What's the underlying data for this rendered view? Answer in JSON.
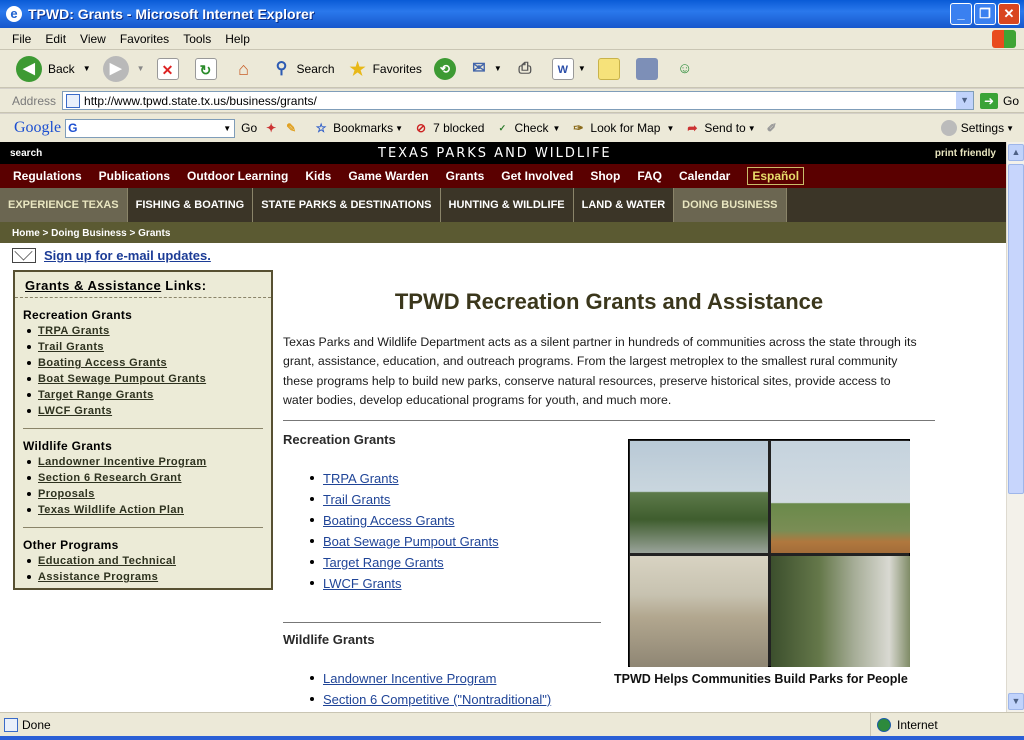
{
  "window": {
    "title": "TPWD: Grants - Microsoft Internet Explorer"
  },
  "menu": [
    "File",
    "Edit",
    "View",
    "Favorites",
    "Tools",
    "Help"
  ],
  "toolbar": {
    "back": "Back",
    "search": "Search",
    "favorites": "Favorites"
  },
  "address": {
    "label": "Address",
    "url": "http://www.tpwd.state.tx.us/business/grants/",
    "go": "Go"
  },
  "google": {
    "logo": "Google",
    "go": "Go",
    "bookmarks": "Bookmarks",
    "blocked": "7 blocked",
    "check": "Check",
    "lookup": "Look for Map",
    "sendto": "Send to",
    "settings": "Settings"
  },
  "site": {
    "search": "search",
    "title": "TEXAS PARKS AND WILDLIFE",
    "print": "print friendly",
    "nav": [
      "Regulations",
      "Publications",
      "Outdoor Learning",
      "Kids",
      "Game Warden",
      "Grants",
      "Get Involved",
      "Shop",
      "FAQ",
      "Calendar"
    ],
    "espanol": "Español",
    "tabs": [
      "EXPERIENCE TEXAS",
      "FISHING & BOATING",
      "STATE PARKS & DESTINATIONS",
      "HUNTING & WILDLIFE",
      "LAND & WATER",
      "DOING BUSINESS"
    ],
    "breadcrumb": "Home > Doing Business > Grants",
    "email": "Sign up for e-mail updates."
  },
  "sidebar": {
    "heading_link": "Grants & Assistance",
    "heading_rest": " Links:",
    "groups": [
      {
        "title": "Recreation Grants",
        "items": [
          "TRPA Grants",
          "Trail Grants",
          "Boating Access Grants",
          "Boat Sewage Pumpout Grants",
          "Target Range Grants",
          "LWCF Grants"
        ]
      },
      {
        "title": "Wildlife Grants",
        "items": [
          "Landowner Incentive Program",
          "Section 6 Research Grant",
          "Proposals",
          "Texas Wildlife Action Plan"
        ]
      },
      {
        "title": "Other Programs",
        "items": [
          "Education and Technical",
          "Assistance Programs"
        ]
      }
    ]
  },
  "main": {
    "heading": "TPWD Recreation Grants and Assistance",
    "intro": "Texas Parks and Wildlife Department acts as a silent partner in hundreds of communities across the state through its grant, assistance, education, and outreach programs. From the largest metroplex to the smallest rural community these programs help to build new parks, conserve natural resources, preserve historical sites, provide access to water bodies, develop educational programs for youth, and much more.",
    "recreation_heading": "Recreation Grants",
    "recreation_items": [
      "TRPA Grants",
      "Trail Grants",
      "Boating Access Grants",
      "Boat Sewage Pumpout Grants",
      "Target Range Grants",
      "LWCF Grants"
    ],
    "wildlife_heading": "Wildlife Grants",
    "wildlife_items": [
      "Landowner Incentive Program",
      "Section 6 Competitive (\"Nontraditional\")"
    ],
    "caption": "TPWD Helps Communities Build Parks for People"
  },
  "status": {
    "text": "Done",
    "zone": "Internet"
  }
}
